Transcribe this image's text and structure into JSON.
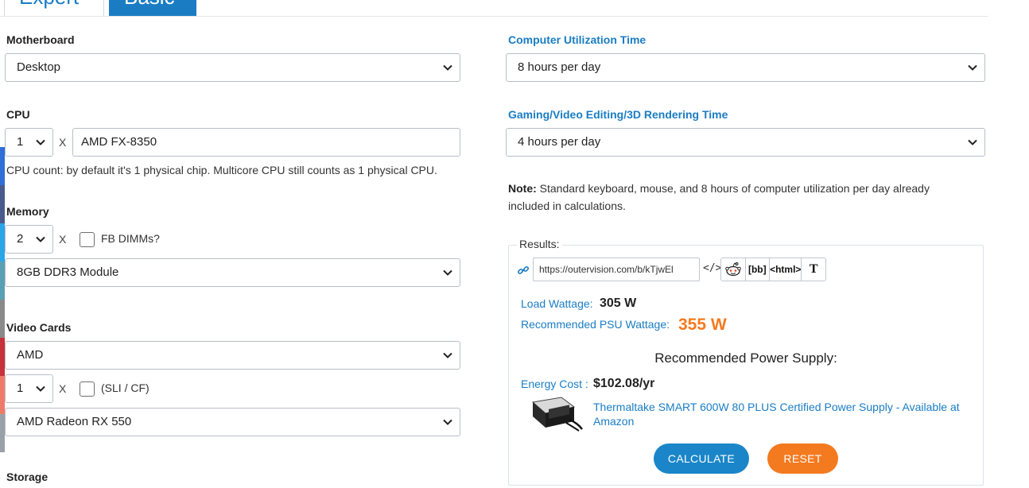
{
  "tabs": {
    "expert": "Expert",
    "basic": "Basic"
  },
  "motherboard": {
    "label": "Motherboard",
    "value": "Desktop"
  },
  "cpu": {
    "label": "CPU",
    "count": "1",
    "x": "X",
    "model": "AMD FX-8350",
    "hint": "CPU count: by default it's 1 physical chip. Multicore CPU still counts as 1 physical CPU."
  },
  "memory": {
    "label": "Memory",
    "count": "2",
    "x": "X",
    "fb_dimms_label": "FB DIMMs?",
    "module": "8GB DDR3 Module"
  },
  "video_cards": {
    "label": "Video Cards",
    "brand": "AMD",
    "count": "1",
    "x": "X",
    "sli_label": "(SLI / CF)",
    "model": "AMD Radeon RX 550"
  },
  "storage": {
    "label": "Storage"
  },
  "utilization": {
    "label": "Computer Utilization Time",
    "value": "8 hours per day"
  },
  "gaming": {
    "label": "Gaming/Video Editing/3D Rendering Time",
    "value": "4 hours per day"
  },
  "note": {
    "bold": "Note:",
    "text": " Standard keyboard, mouse, and 8 hours of computer utilization per day already included in calculations."
  },
  "results": {
    "legend": "Results:",
    "url": "https://outervision.com/b/kTjwEl",
    "embed_symbol": "</>",
    "share": {
      "bb": "[bb]",
      "html": "<html>",
      "text": "T"
    },
    "load_label": "Load Wattage:",
    "load_value": "305 W",
    "psu_label": "Recommended PSU Wattage:",
    "psu_value": "355 W",
    "rec_title": "Recommended Power Supply:",
    "energy_label": "Energy Cost :",
    "energy_value": "$102.08/yr",
    "product_text": "Thermaltake SMART 600W 80 PLUS Certified Power Supply - Available at Amazon",
    "calculate": "CALCULATE",
    "reset": "RESET"
  },
  "colors": {
    "accent": "#1a7dc4",
    "orange": "#f47a1f",
    "strip": [
      "#2f6fd6",
      "#4a5a8c",
      "#2aa6e8",
      "#5aa0b4",
      "#8a8a8a",
      "#c8323c",
      "#f07a6a",
      "#9aa0a8"
    ]
  },
  "icons": [
    "chevron-down-icon",
    "link-icon",
    "embed-icon",
    "reddit-icon",
    "product-image"
  ]
}
